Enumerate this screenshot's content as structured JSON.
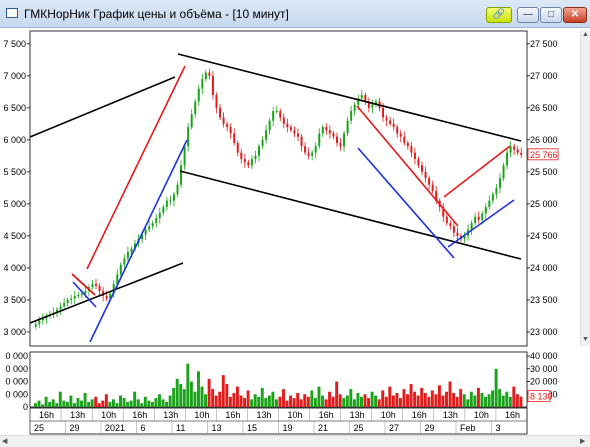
{
  "window": {
    "title": "ГМКНорНик График цены и объёма - [10 минут]",
    "buttons": {
      "link": "🔗",
      "minimize": "—",
      "maximize": "□",
      "close": "✕"
    }
  },
  "colors": {
    "up": "#1aa31a",
    "down": "#e31b1b",
    "trend_red": "#e81818",
    "trend_blue": "#1d33e0",
    "trend_black": "#000000",
    "last_price": "#e31b1b"
  },
  "last_price_label": "25 766",
  "last_volume_label": "8 130",
  "chart_data": [
    {
      "type": "candlestick",
      "price_axis": {
        "left_ticks": [
          "3 000",
          "3 500",
          "4 000",
          "4 500",
          "5 000",
          "5 500",
          "6 000",
          "6 500",
          "7 000",
          "7 500"
        ],
        "right_ticks": [
          "23 000",
          "23 500",
          "24 000",
          "24 500",
          "25 000",
          "25 500",
          "26 000",
          "26 500",
          "27 000",
          "27 500"
        ],
        "right_range": [
          22780,
          27700
        ]
      },
      "x_axis": {
        "top_row": [
          "16h",
          "13h",
          "10h",
          "16h",
          "13h",
          "10h",
          "16h",
          "13h",
          "10h",
          "16h",
          "13h",
          "10h",
          "16h",
          "13h",
          "10h",
          "16h"
        ],
        "bottom_row": [
          "25",
          "29",
          "2021",
          "6",
          "11",
          "13",
          "15",
          "19",
          "21",
          "25",
          "27",
          "29",
          "Feb",
          "3"
        ]
      },
      "series_close": [
        23120,
        23180,
        23210,
        23250,
        23270,
        23300,
        23350,
        23400,
        23450,
        23500,
        23520,
        23560,
        23580,
        23600,
        23640,
        23700,
        23750,
        23720,
        23640,
        23560,
        23520,
        23600,
        23750,
        23900,
        24050,
        24150,
        24250,
        24300,
        24380,
        24450,
        24520,
        24600,
        24650,
        24700,
        24780,
        24860,
        24950,
        25050,
        25050,
        25150,
        25300,
        25600,
        25900,
        26200,
        26400,
        26600,
        26800,
        26950,
        27050,
        27000,
        26700,
        26500,
        26350,
        26250,
        26200,
        26100,
        25950,
        25800,
        25700,
        25650,
        25600,
        25700,
        25750,
        25900,
        26000,
        26150,
        26300,
        26450,
        26450,
        26350,
        26250,
        26200,
        26150,
        26100,
        26050,
        25900,
        25800,
        25750,
        25800,
        25900,
        26100,
        26200,
        26150,
        26100,
        26050,
        25950,
        25900,
        26100,
        26300,
        26450,
        26550,
        26650,
        26700,
        26600,
        26500,
        26550,
        26600,
        26500,
        26350,
        26300,
        26250,
        26200,
        26100,
        26050,
        25950,
        25900,
        25800,
        25700,
        25600,
        25500,
        25400,
        25300,
        25200,
        25050,
        24950,
        24800,
        24700,
        24650,
        24550,
        24500,
        24450,
        24500,
        24600,
        24700,
        24800,
        24750,
        24850,
        24950,
        25050,
        25150,
        25250,
        25400,
        25600,
        25800,
        25900,
        25850,
        25800,
        25766
      ]
    },
    {
      "type": "bar",
      "name": "volume",
      "axis": {
        "left_ticks": [
          "0 000",
          "0 000",
          "0 000",
          "0 000",
          "0"
        ],
        "right_ticks": [
          "40 000",
          "30 000",
          "20 000",
          "10 000"
        ],
        "max": 40000
      },
      "values": [
        3000,
        5000,
        2000,
        8000,
        4000,
        6000,
        3000,
        12000,
        5000,
        4000,
        9000,
        3000,
        7000,
        5000,
        11000,
        4000,
        6000,
        8000,
        3000,
        5000,
        10000,
        4000,
        6000,
        3000,
        9000,
        7000,
        4000,
        5000,
        12000,
        6000,
        3000,
        8000,
        5000,
        4000,
        7000,
        10000,
        6000,
        4000,
        9000,
        15000,
        22000,
        18000,
        14000,
        34000,
        20000,
        12000,
        28000,
        16000,
        10000,
        22000,
        14000,
        9000,
        12000,
        25000,
        18000,
        8000,
        11000,
        16000,
        9000,
        7000,
        13000,
        6000,
        10000,
        8000,
        15000,
        7000,
        9000,
        12000,
        6000,
        8000,
        14000,
        5000,
        9000,
        7000,
        11000,
        6000,
        10000,
        8000,
        13000,
        7000,
        16000,
        9000,
        6000,
        12000,
        8000,
        20000,
        10000,
        7000,
        9000,
        14000,
        6000,
        11000,
        8000,
        10000,
        7000,
        12000,
        9000,
        6000,
        13000,
        8000,
        16000,
        9000,
        11000,
        7000,
        14000,
        10000,
        18000,
        12000,
        9000,
        15000,
        11000,
        8000,
        13000,
        10000,
        17000,
        9000,
        12000,
        20000,
        11000,
        8000,
        14000,
        10000,
        6000,
        12000,
        9000,
        15000,
        11000,
        8000,
        10000,
        13000,
        30000,
        14000,
        9000,
        12000,
        8000,
        16000,
        10000,
        8130
      ]
    }
  ]
}
